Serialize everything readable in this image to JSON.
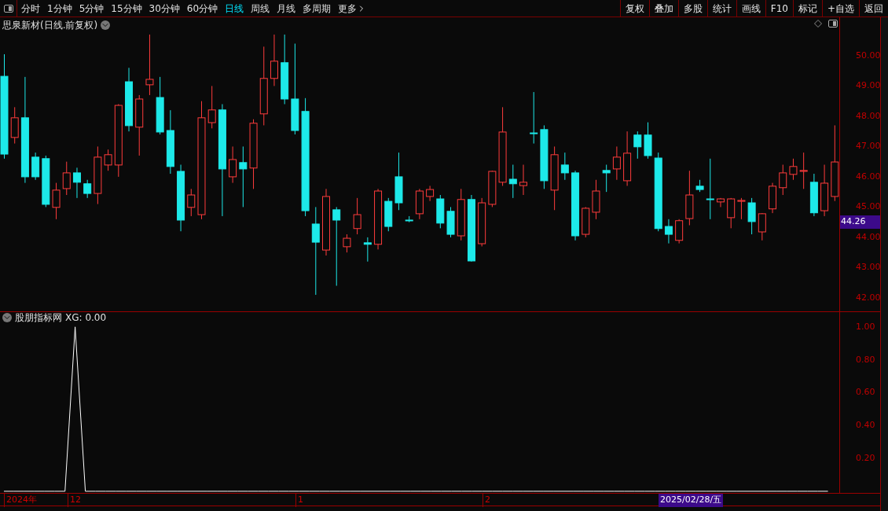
{
  "toolbar": {
    "periods": [
      {
        "label": "分时",
        "selected": false
      },
      {
        "label": "1分钟",
        "selected": false
      },
      {
        "label": "5分钟",
        "selected": false
      },
      {
        "label": "15分钟",
        "selected": false
      },
      {
        "label": "30分钟",
        "selected": false
      },
      {
        "label": "60分钟",
        "selected": false
      },
      {
        "label": "日线",
        "selected": true
      },
      {
        "label": "周线",
        "selected": false
      },
      {
        "label": "月线",
        "selected": false
      },
      {
        "label": "多周期",
        "selected": false
      }
    ],
    "more": "更多",
    "buttons": [
      "复权",
      "叠加",
      "多股",
      "统计",
      "画线",
      "F10",
      "标记",
      "+自选",
      "返回"
    ]
  },
  "price_pane": {
    "title": "思泉新材(日线.前复权)",
    "current_price": "44.26",
    "chart_data": {
      "type": "candlestick",
      "ylim": [
        41.53,
        51.27
      ],
      "yticks": [
        {
          "value": 50,
          "label": "50.00"
        },
        {
          "value": 49,
          "label": "49.00"
        },
        {
          "value": 48,
          "label": "48.00"
        },
        {
          "value": 47,
          "label": "47.00"
        },
        {
          "value": 46,
          "label": "46.00"
        },
        {
          "value": 45,
          "label": "45.00"
        },
        {
          "value": 44,
          "label": "44.00"
        },
        {
          "value": 43,
          "label": "43.00"
        },
        {
          "value": 42,
          "label": "42.00"
        }
      ],
      "ohlc": [
        [
          49.32,
          50.05,
          46.6,
          46.75
        ],
        [
          47.3,
          48.3,
          47.1,
          47.95
        ],
        [
          47.95,
          49.3,
          45.8,
          46.0
        ],
        [
          46.65,
          46.8,
          45.9,
          46.0
        ],
        [
          46.6,
          46.7,
          45.0,
          45.09
        ],
        [
          44.99,
          45.8,
          44.6,
          45.56
        ],
        [
          45.61,
          46.5,
          45.4,
          46.13
        ],
        [
          46.13,
          46.3,
          45.3,
          45.82
        ],
        [
          45.77,
          45.9,
          45.3,
          45.45
        ],
        [
          45.45,
          47.0,
          45.1,
          46.65
        ],
        [
          46.39,
          46.9,
          46.2,
          46.73
        ],
        [
          46.39,
          48.4,
          46.0,
          48.36
        ],
        [
          49.14,
          49.6,
          47.5,
          47.69
        ],
        [
          47.64,
          48.7,
          46.7,
          48.57
        ],
        [
          49.04,
          50.7,
          48.7,
          49.22
        ],
        [
          48.62,
          49.3,
          47.4,
          47.48
        ],
        [
          47.53,
          48.2,
          46.1,
          46.34
        ],
        [
          46.18,
          46.4,
          44.2,
          44.57
        ],
        [
          44.99,
          45.6,
          44.7,
          45.4
        ],
        [
          44.75,
          48.5,
          44.6,
          47.95
        ],
        [
          47.79,
          49.0,
          47.6,
          48.21
        ],
        [
          48.21,
          48.4,
          44.7,
          46.26
        ],
        [
          46.0,
          47.0,
          45.8,
          46.57
        ],
        [
          46.47,
          47.0,
          45.0,
          46.26
        ],
        [
          46.29,
          47.9,
          45.6,
          47.77
        ],
        [
          48.08,
          50.3,
          47.7,
          49.25
        ],
        [
          49.25,
          50.7,
          49.0,
          49.82
        ],
        [
          49.77,
          50.7,
          48.4,
          48.57
        ],
        [
          48.57,
          50.4,
          47.4,
          47.53
        ],
        [
          48.16,
          48.6,
          44.7,
          44.88
        ],
        [
          44.44,
          45.0,
          42.1,
          43.84
        ],
        [
          43.58,
          45.6,
          43.4,
          45.35
        ],
        [
          44.91,
          45.0,
          42.4,
          44.57
        ],
        [
          43.69,
          44.1,
          43.5,
          43.97
        ],
        [
          44.29,
          45.3,
          44.1,
          44.75
        ],
        [
          43.82,
          44.0,
          43.2,
          43.77
        ],
        [
          43.77,
          45.6,
          43.6,
          45.53
        ],
        [
          45.19,
          45.3,
          44.2,
          44.36
        ],
        [
          46.0,
          46.8,
          44.9,
          45.14
        ],
        [
          44.57,
          44.7,
          44.5,
          44.55
        ],
        [
          44.78,
          45.6,
          44.6,
          45.53
        ],
        [
          45.35,
          45.7,
          45.2,
          45.58
        ],
        [
          45.27,
          45.4,
          44.3,
          44.47
        ],
        [
          44.86,
          45.0,
          44.0,
          44.1
        ],
        [
          44.05,
          45.6,
          43.9,
          45.25
        ],
        [
          45.25,
          45.4,
          43.2,
          43.22
        ],
        [
          43.79,
          45.3,
          43.7,
          45.14
        ],
        [
          45.09,
          46.2,
          45.0,
          46.18
        ],
        [
          45.82,
          48.3,
          45.7,
          47.48
        ],
        [
          45.92,
          46.4,
          45.3,
          45.77
        ],
        [
          45.71,
          46.4,
          45.4,
          45.82
        ],
        [
          47.45,
          48.8,
          47.1,
          47.43
        ],
        [
          47.56,
          47.7,
          45.6,
          45.87
        ],
        [
          45.56,
          47.0,
          44.9,
          46.73
        ],
        [
          46.39,
          46.8,
          45.9,
          46.13
        ],
        [
          46.13,
          46.2,
          43.9,
          44.05
        ],
        [
          44.1,
          45.0,
          44.0,
          44.96
        ],
        [
          44.83,
          45.9,
          44.6,
          45.53
        ],
        [
          46.21,
          46.4,
          45.5,
          46.13
        ],
        [
          46.26,
          47.0,
          45.9,
          46.65
        ],
        [
          45.87,
          47.5,
          45.7,
          46.78
        ],
        [
          47.38,
          47.5,
          46.6,
          46.99
        ],
        [
          47.38,
          47.8,
          46.6,
          46.7
        ],
        [
          46.62,
          46.8,
          44.2,
          44.29
        ],
        [
          44.36,
          44.6,
          43.8,
          44.1
        ],
        [
          43.9,
          44.6,
          43.8,
          44.55
        ],
        [
          44.62,
          46.2,
          44.4,
          45.4
        ],
        [
          45.69,
          45.9,
          45.5,
          45.58
        ],
        [
          45.27,
          46.6,
          44.6,
          45.25
        ],
        [
          45.17,
          45.3,
          45.0,
          45.27
        ],
        [
          44.65,
          45.3,
          44.3,
          45.27
        ],
        [
          45.19,
          45.3,
          44.6,
          45.22
        ],
        [
          45.14,
          45.3,
          44.1,
          44.52
        ],
        [
          44.18,
          44.8,
          43.9,
          44.78
        ],
        [
          44.94,
          45.8,
          44.8,
          45.69
        ],
        [
          45.64,
          46.4,
          45.4,
          46.13
        ],
        [
          46.08,
          46.6,
          45.9,
          46.34
        ],
        [
          46.18,
          46.8,
          45.6,
          46.21
        ],
        [
          45.82,
          46.1,
          44.7,
          44.81
        ],
        [
          44.88,
          46.4,
          44.7,
          45.79
        ],
        [
          45.35,
          47.7,
          45.2,
          46.49
        ]
      ]
    }
  },
  "indicator_pane": {
    "title": "股朋指标网",
    "reading": ": 0.00",
    "chart_data": {
      "type": "line",
      "ylim": [
        -0.01,
        1.09
      ],
      "yticks": [
        {
          "value": 0.2,
          "label": "0.20"
        },
        {
          "value": 0.4,
          "label": "0.40"
        },
        {
          "value": 0.6,
          "label": "0.60"
        },
        {
          "value": 0.8,
          "label": "0.80"
        },
        {
          "value": 1,
          "label": "1.00"
        }
      ],
      "series": [
        {
          "name": "XG",
          "color": "#ffffff",
          "values": [
            0,
            0,
            0,
            0,
            0,
            0,
            0,
            1,
            0,
            0,
            0,
            0,
            0,
            0,
            0,
            0,
            0,
            0,
            0,
            0,
            0,
            0,
            0,
            0,
            0,
            0,
            0,
            0,
            0,
            0,
            0,
            0,
            0,
            0,
            0,
            0,
            0,
            0,
            0,
            0,
            0,
            0,
            0,
            0,
            0,
            0,
            0,
            0,
            0,
            0,
            0,
            0,
            0,
            0,
            0,
            0,
            0,
            0,
            0,
            0,
            0,
            0,
            0,
            0,
            0,
            0,
            0,
            0,
            0,
            0,
            0,
            0,
            0,
            0,
            0,
            0,
            0,
            0,
            0,
            0,
            0,
            0
          ]
        }
      ]
    }
  },
  "time_axis": {
    "labels": [
      "2024年",
      "12",
      "1",
      "2"
    ],
    "cursor_date": "2025/02/28/五"
  }
}
